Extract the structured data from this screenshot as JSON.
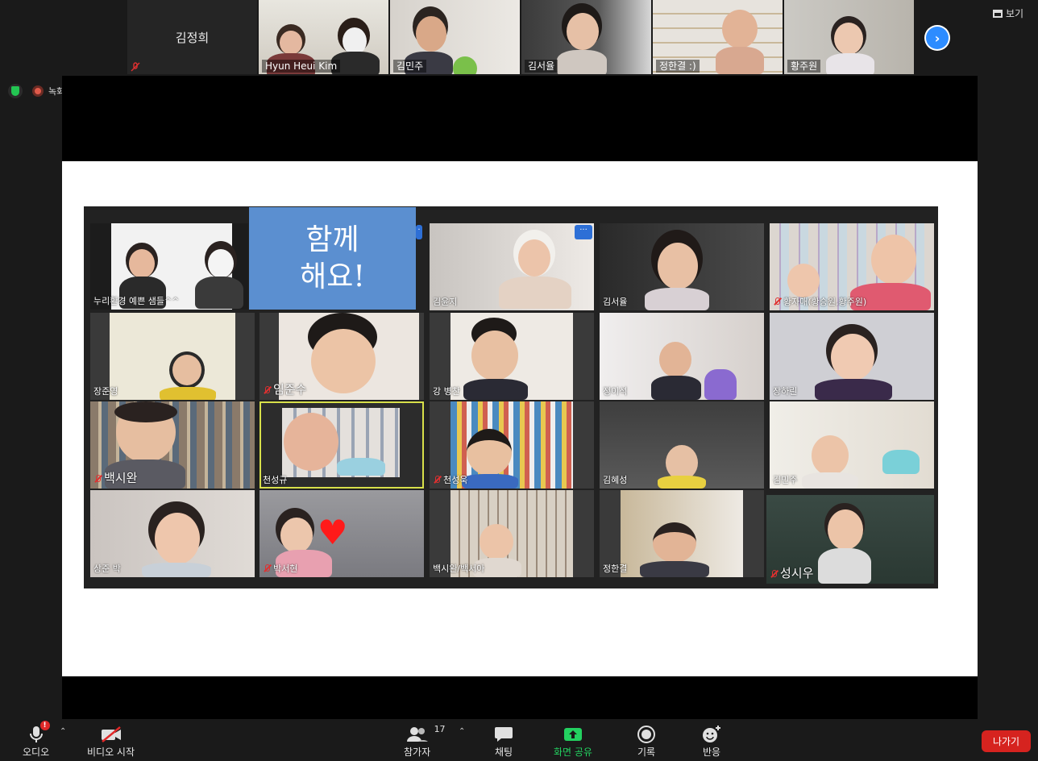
{
  "strip": {
    "first_name": "김정희",
    "tiles": [
      {
        "name": "Hyun Heui Kim"
      },
      {
        "name": "김민주"
      },
      {
        "name": "김서율"
      },
      {
        "name": "정한결 :)"
      },
      {
        "name": "황주원"
      }
    ]
  },
  "view_label": "보기",
  "recording_label": "녹화",
  "slide": {
    "card_line1": "함께",
    "card_line2": "해요!",
    "cells": [
      {
        "name": "누리환경 예쁜 샘들^^"
      },
      {
        "name": "김윤지"
      },
      {
        "name": "김서율"
      },
      {
        "name": "황자매(황승원,황주원)"
      },
      {
        "name": "장준영"
      },
      {
        "name": "임준수"
      },
      {
        "name": "강 병찬"
      },
      {
        "name": "정이석"
      },
      {
        "name": "장하린"
      },
      {
        "name": "백시완"
      },
      {
        "name": "천성규"
      },
      {
        "name": "천성욱"
      },
      {
        "name": "김혜성"
      },
      {
        "name": "김민주"
      },
      {
        "name": "상준 박"
      },
      {
        "name": "박서현"
      },
      {
        "name": "백시완/백서아"
      },
      {
        "name": "정한결"
      },
      {
        "name": "성시우"
      }
    ]
  },
  "toolbar": {
    "audio": "오디오",
    "video": "비디오 시작",
    "participants": "참가자",
    "participants_count": "17",
    "chat": "채팅",
    "share": "화면 공유",
    "record": "기록",
    "reactions": "반응",
    "leave": "나가기",
    "audio_badge": "!"
  },
  "colors": {
    "accent_blue": "#2d8cff",
    "share_green": "#23d160",
    "leave_red": "#d6231f",
    "active_speaker": "#a8c25a"
  }
}
